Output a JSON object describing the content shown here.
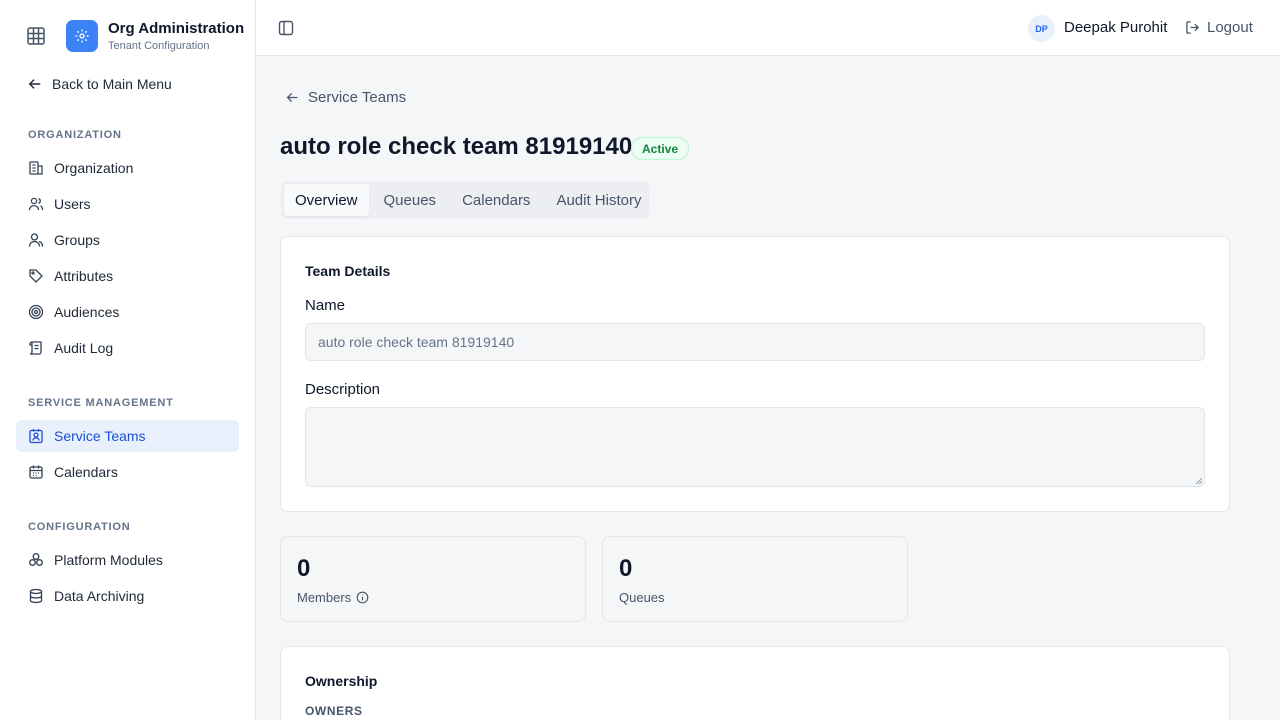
{
  "brand": {
    "title": "Org Administration",
    "subtitle": "Tenant Configuration",
    "app_switcher_icon": "grid-icon",
    "logo_icon": "gear-icon",
    "logo_color": "#3b82f6"
  },
  "sidebar": {
    "back_label": "Back to Main Menu",
    "sections": [
      {
        "label": "ORGANIZATION",
        "items": [
          {
            "label": "Organization",
            "icon": "building-icon"
          },
          {
            "label": "Users",
            "icon": "users-icon"
          },
          {
            "label": "Groups",
            "icon": "group-icon"
          },
          {
            "label": "Attributes",
            "icon": "tag-icon"
          },
          {
            "label": "Audiences",
            "icon": "target-icon"
          },
          {
            "label": "Audit Log",
            "icon": "scroll-icon"
          }
        ]
      },
      {
        "label": "SERVICE MANAGEMENT",
        "items": [
          {
            "label": "Service Teams",
            "icon": "contact-badge-icon",
            "active": true
          },
          {
            "label": "Calendars",
            "icon": "calendar-icon"
          }
        ]
      },
      {
        "label": "CONFIGURATION",
        "items": [
          {
            "label": "Platform Modules",
            "icon": "modules-icon"
          },
          {
            "label": "Data Archiving",
            "icon": "database-icon"
          }
        ]
      }
    ],
    "active_color": "#1d4ed8",
    "active_bg": "#e8f0fb"
  },
  "header": {
    "user_initials": "DP",
    "user_name": "Deepak Purohit",
    "logout_label": "Logout"
  },
  "main": {
    "breadcrumb": "Service Teams",
    "title": "auto role check team 81919140",
    "status": "Active",
    "status_color": "#15803d",
    "tabs": [
      {
        "label": "Overview",
        "active": true
      },
      {
        "label": "Queues"
      },
      {
        "label": "Calendars"
      },
      {
        "label": "Audit History"
      }
    ],
    "details": {
      "title": "Team Details",
      "name_label": "Name",
      "name_value": "auto role check team 81919140",
      "description_label": "Description",
      "description_value": ""
    },
    "stats": [
      {
        "value": "0",
        "label": "Members",
        "info_icon": "info-icon"
      },
      {
        "value": "0",
        "label": "Queues"
      }
    ],
    "ownership": {
      "title": "Ownership",
      "owners_label": "OWNERS"
    }
  }
}
